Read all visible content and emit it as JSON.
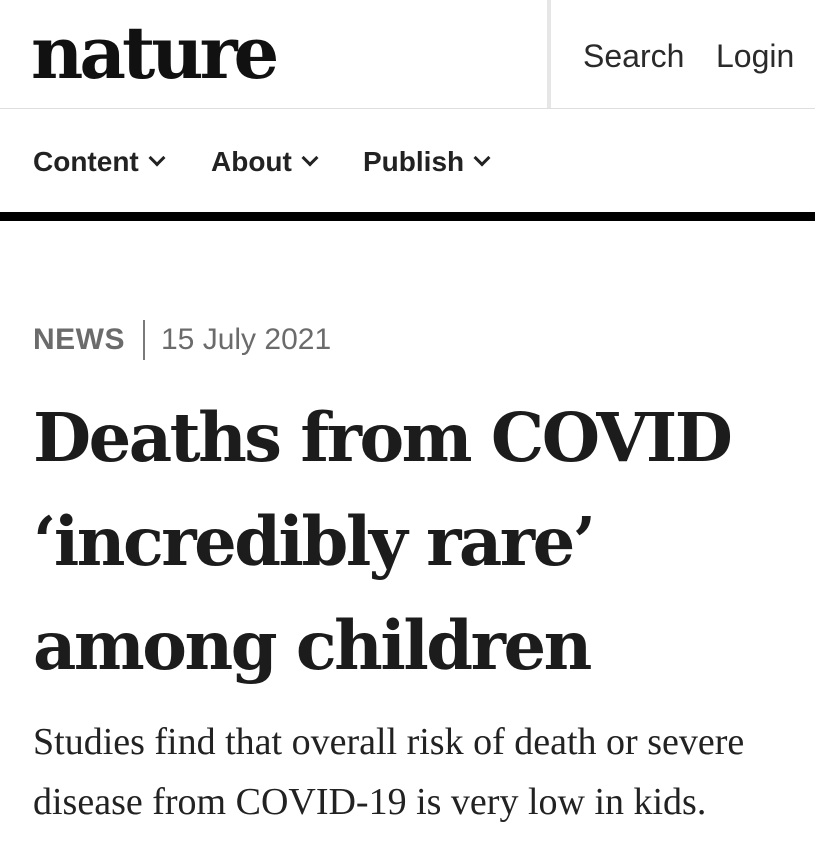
{
  "header": {
    "logo": "nature",
    "search_label": "Search",
    "login_label": "Login"
  },
  "nav": {
    "items": [
      {
        "label": "Content"
      },
      {
        "label": "About"
      },
      {
        "label": "Publish"
      }
    ]
  },
  "article": {
    "type": "NEWS",
    "date": "15 July 2021",
    "headline_lines": [
      "Deaths from COVID",
      "‘incredibly rare’",
      "among children"
    ],
    "standfirst_lines": [
      "Studies find that overall risk of death or severe",
      "disease from COVID-19 is very low in kids."
    ]
  }
}
